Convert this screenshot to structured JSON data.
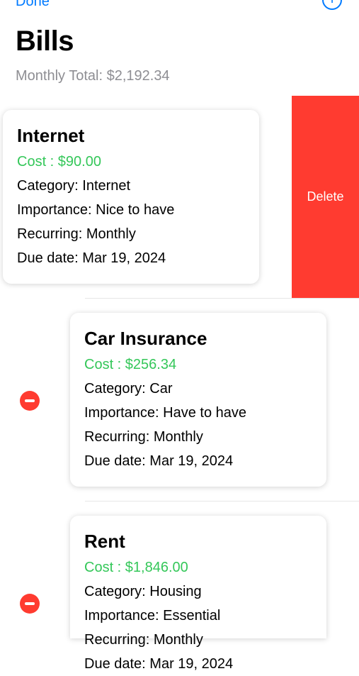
{
  "nav": {
    "done_label": "Done",
    "add_symbol": "+"
  },
  "header": {
    "title": "Bills",
    "monthly_total": "Monthly Total: $2,192.34"
  },
  "swipe_action": {
    "label": "Delete"
  },
  "bills": [
    {
      "name": "Internet",
      "cost": "Cost : $90.00",
      "category": "Category: Internet",
      "importance": "Importance: Nice to have",
      "recurring": "Recurring: Monthly",
      "due": "Due date: Mar 19, 2024"
    },
    {
      "name": "Car Insurance",
      "cost": "Cost : $256.34",
      "category": "Category: Car",
      "importance": "Importance: Have to have",
      "recurring": "Recurring: Monthly",
      "due": "Due date: Mar 19, 2024"
    },
    {
      "name": "Rent",
      "cost": "Cost : $1,846.00",
      "category": "Category: Housing",
      "importance": "Importance: Essential",
      "recurring": "Recurring: Monthly",
      "due": "Due date: Mar 19, 2024"
    }
  ],
  "colors": {
    "accent": "#007aff",
    "delete": "#ff3b30",
    "cost": "#34c759",
    "subtitle": "#8e8e93"
  }
}
